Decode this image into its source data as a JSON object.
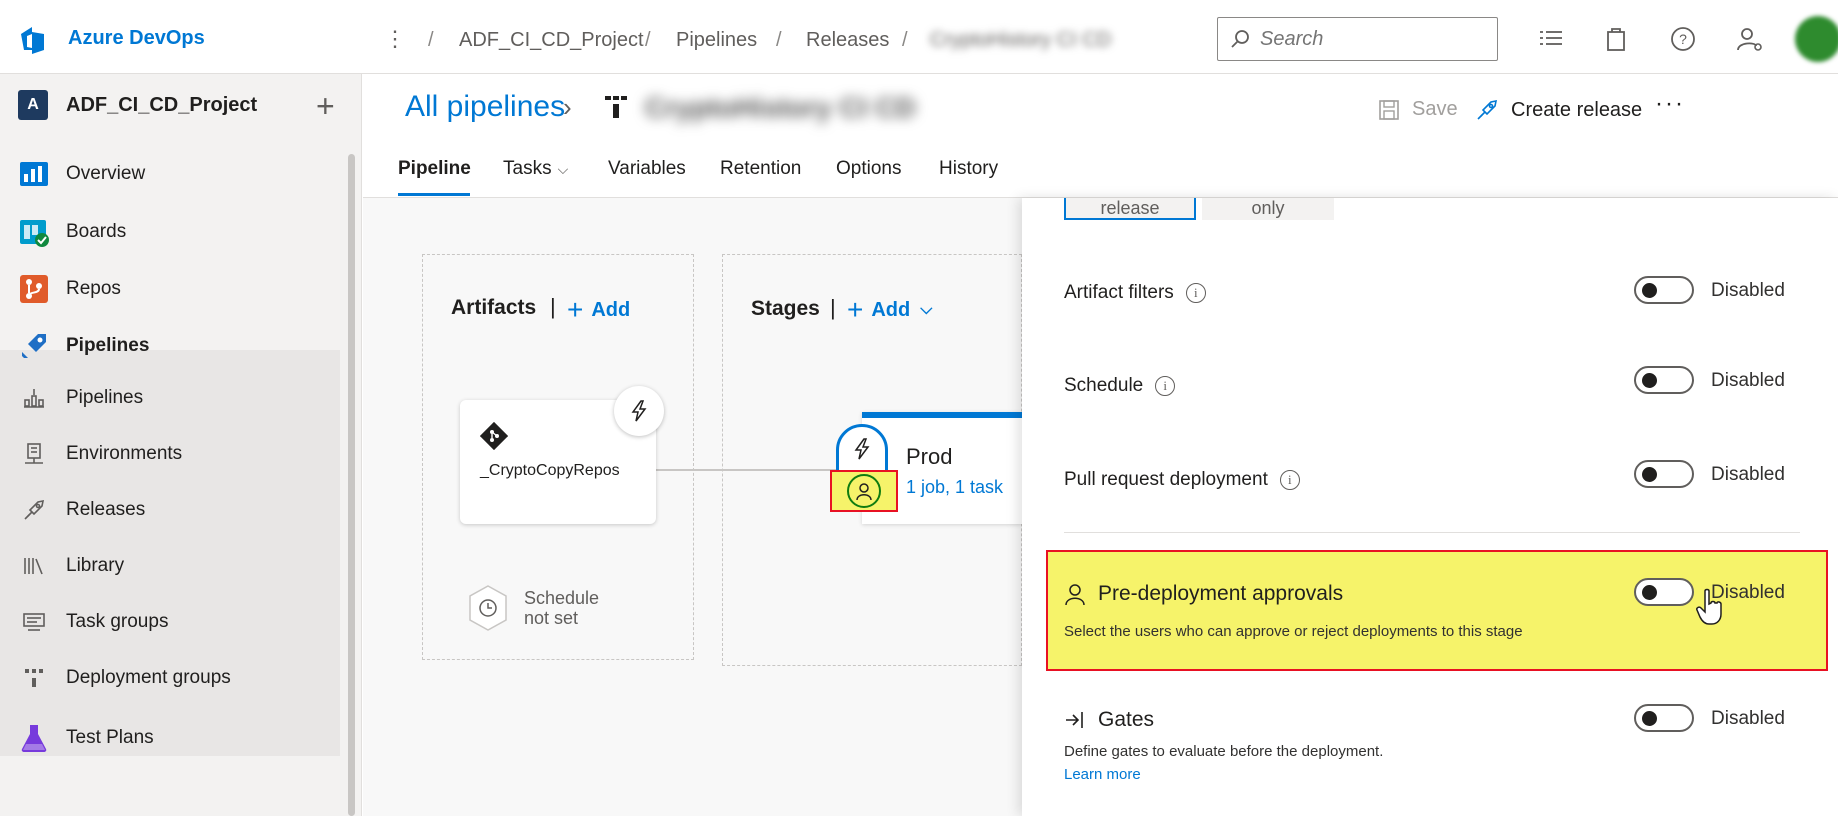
{
  "topbar": {
    "brand": "Azure DevOps",
    "breadcrumbs": [
      "ADF_CI_CD_Project",
      "Pipelines",
      "Releases"
    ],
    "breadcrumb_blurred": "CryptoHistory CI CD",
    "search_placeholder": "Search"
  },
  "sidebar": {
    "project_badge": "A",
    "project_name": "ADF_CI_CD_Project",
    "items": [
      {
        "label": "Overview",
        "icon": "overview-icon"
      },
      {
        "label": "Boards",
        "icon": "boards-icon"
      },
      {
        "label": "Repos",
        "icon": "repos-icon"
      },
      {
        "label": "Pipelines",
        "icon": "pipelines-icon"
      },
      {
        "label": "Pipelines",
        "icon": "pipelines-sub-icon"
      },
      {
        "label": "Environments",
        "icon": "environments-icon"
      },
      {
        "label": "Releases",
        "icon": "releases-icon"
      },
      {
        "label": "Library",
        "icon": "library-icon"
      },
      {
        "label": "Task groups",
        "icon": "task-groups-icon"
      },
      {
        "label": "Deployment groups",
        "icon": "deployment-groups-icon"
      },
      {
        "label": "Test Plans",
        "icon": "test-plans-icon"
      }
    ]
  },
  "header": {
    "all_pipelines": "All pipelines",
    "pipeline_name_blurred": "CryptoHistory CI CD",
    "save": "Save",
    "create_release": "Create release",
    "more": "···",
    "tabs": [
      "Pipeline",
      "Tasks",
      "Variables",
      "Retention",
      "Options",
      "History"
    ]
  },
  "canvas": {
    "artifacts_title": "Artifacts",
    "stages_title": "Stages",
    "add": "Add",
    "artifact_name": "_CryptoCopyRepos",
    "stage_name": "Prod",
    "stage_meta": "1 job, 1 task",
    "schedule_line1": "Schedule",
    "schedule_line2": "not set"
  },
  "panel": {
    "seg_a": "release",
    "seg_b": "only",
    "rows": [
      {
        "label": "Artifact filters",
        "state": "Disabled"
      },
      {
        "label": "Schedule",
        "state": "Disabled"
      },
      {
        "label": "Pull request deployment",
        "state": "Disabled"
      }
    ],
    "approvals": {
      "title": "Pre-deployment approvals",
      "desc": "Select the users who can approve or reject deployments to this stage",
      "state": "Disabled"
    },
    "gates": {
      "title": "Gates",
      "desc": "Define gates to evaluate before the deployment.",
      "learn": "Learn more",
      "state": "Disabled"
    }
  },
  "colors": {
    "accent": "#0078d4",
    "highlight": "#f6f36a",
    "highlight_border": "#e81123"
  }
}
